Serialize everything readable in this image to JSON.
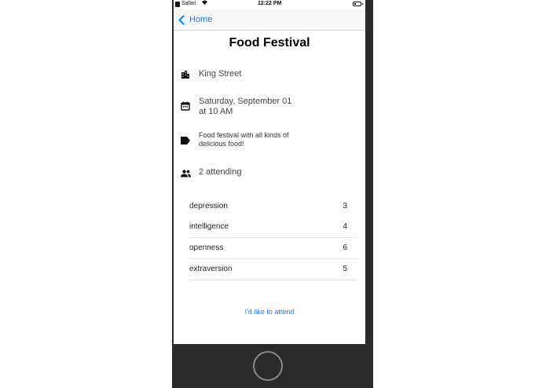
{
  "status_bar": {
    "app": "Safari",
    "time": "12:22 PM"
  },
  "nav": {
    "back_label": "Home"
  },
  "event": {
    "title": "Food Festival",
    "location": "King Street",
    "date_line1": "Saturday, September 01",
    "date_line2": "at 10 AM",
    "description_line1": "Food festival with all kinds of",
    "description_line2": "delicious food!",
    "attending": "2 attending"
  },
  "traits": [
    {
      "name": "depression",
      "count": "3"
    },
    {
      "name": "intelligence",
      "count": "4"
    },
    {
      "name": "openness",
      "count": "6"
    },
    {
      "name": "extraversion",
      "count": "5"
    }
  ],
  "actions": {
    "attend_label": "I'd like to attend"
  },
  "colors": {
    "accent": "#1a7ee6",
    "phone_frame": "#2a2a2a"
  },
  "icons": {
    "location": "building-icon",
    "date": "calendar-icon",
    "description": "label-icon",
    "attending": "people-icon"
  }
}
